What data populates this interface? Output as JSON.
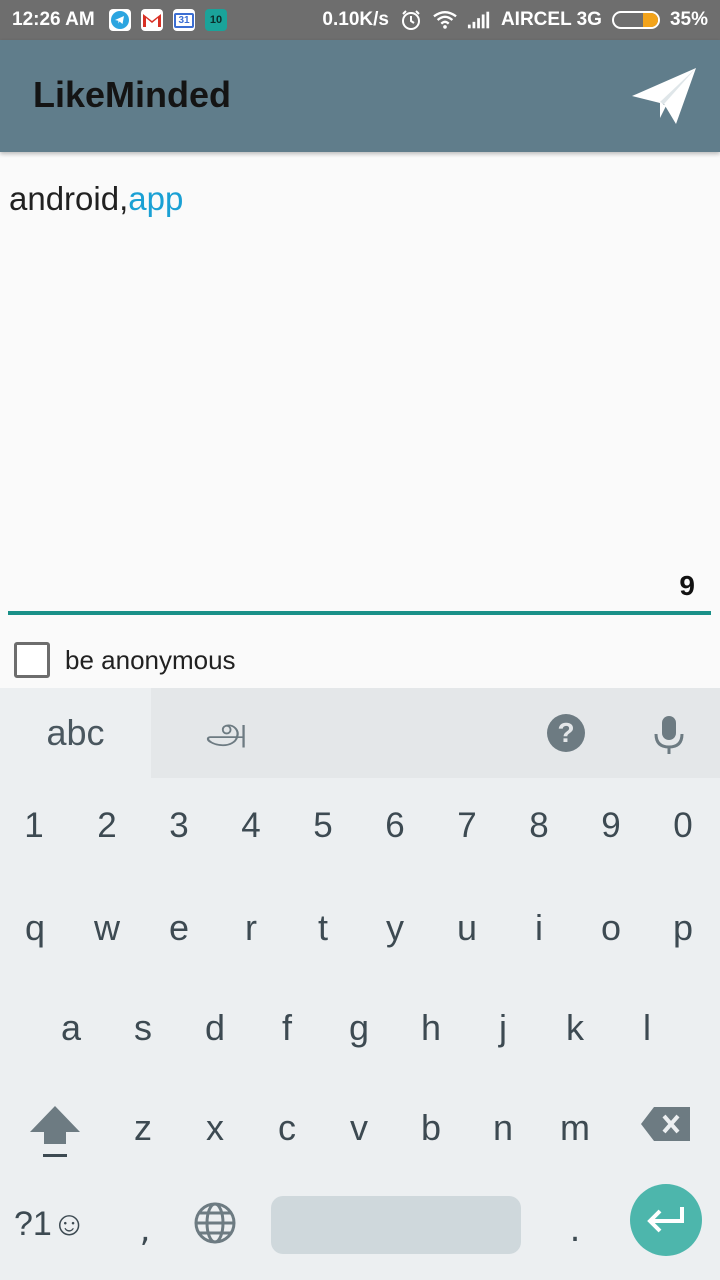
{
  "status_bar": {
    "time": "12:26 AM",
    "notifications": [
      "telegram-icon",
      "gmail-icon",
      "calendar-icon",
      "app-icon"
    ],
    "calendar_day": "31",
    "badge_number": "10",
    "speed": "0.10K/s",
    "carrier": "AIRCEL 3G",
    "battery_percent": "35%",
    "battery_level": 0.35
  },
  "app_bar": {
    "title": "LikeMinded",
    "send_icon": "send-paper-plane-icon"
  },
  "editor": {
    "text_plain": "android,",
    "text_tag": "app",
    "char_count": "9"
  },
  "anonymous": {
    "label": "be anonymous",
    "checked": false
  },
  "keyboard": {
    "tab_abc": "abc",
    "tab_tamil": "அ",
    "help": "?",
    "row_numbers": [
      "1",
      "2",
      "3",
      "4",
      "5",
      "6",
      "7",
      "8",
      "9",
      "0"
    ],
    "row_1": [
      "q",
      "w",
      "e",
      "r",
      "t",
      "y",
      "u",
      "i",
      "o",
      "p"
    ],
    "row_2": [
      "a",
      "s",
      "d",
      "f",
      "g",
      "h",
      "j",
      "k",
      "l"
    ],
    "row_3": [
      "z",
      "x",
      "c",
      "v",
      "b",
      "n",
      "m"
    ],
    "sym_label": "?1☺",
    "comma": ",",
    "period": "."
  },
  "colors": {
    "app_bar": "#607d8b",
    "underline": "#1a9088",
    "tag": "#1aa0d4",
    "enter": "#4db6ac"
  }
}
